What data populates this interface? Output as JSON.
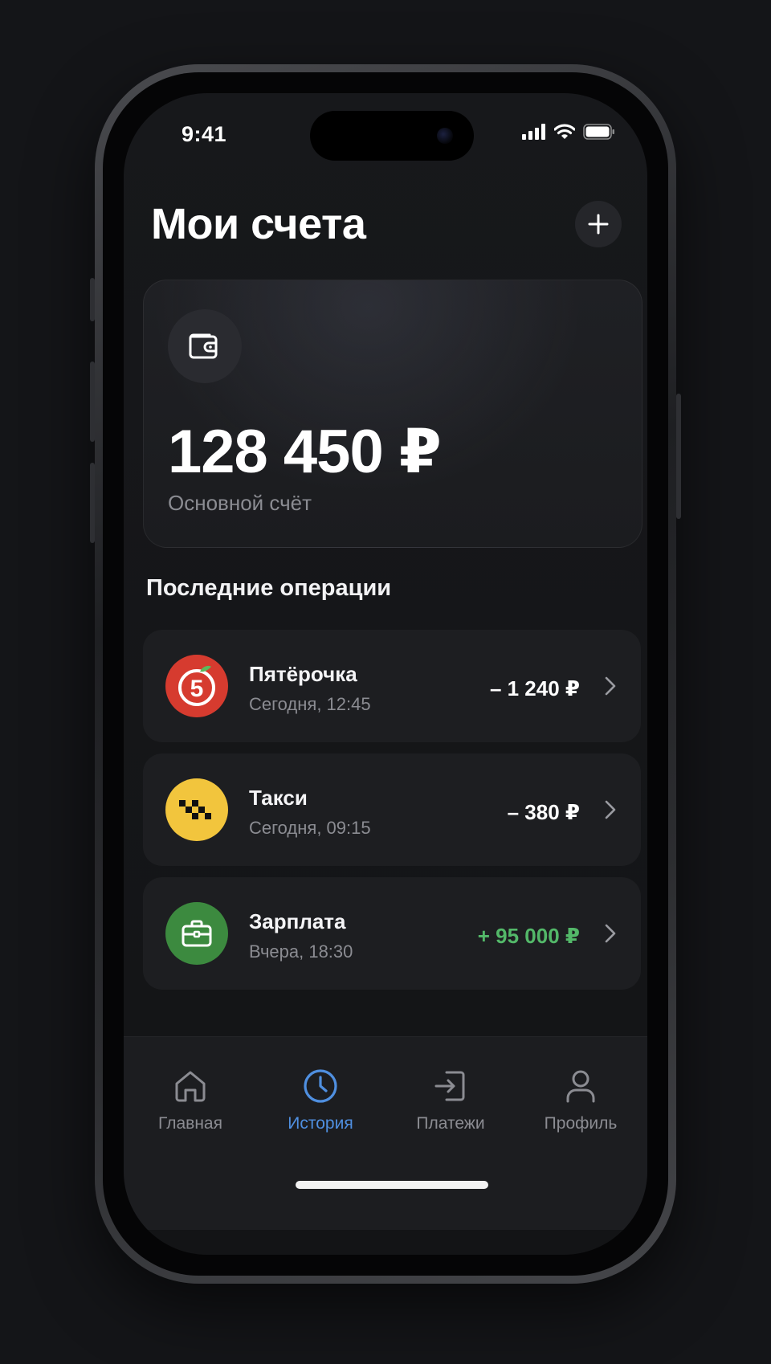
{
  "status_bar": {
    "time": "9:41"
  },
  "header": {
    "title": "Мои счета"
  },
  "account": {
    "balance": "128 450 ₽",
    "name": "Основной счёт"
  },
  "operations": {
    "title": "Последние операции",
    "items": [
      {
        "title": "Пятёрочка",
        "time": "Сегодня, 12:45",
        "amount": "– 1 240 ₽",
        "icon": "pyaterochka-logo-icon",
        "color": "#d63b2f"
      },
      {
        "title": "Такси",
        "time": "Сегодня, 09:15",
        "amount": "– 380 ₽",
        "icon": "taxi-icon",
        "color": "#f2c53d"
      },
      {
        "title": "Зарплата",
        "time": "Вчера, 18:30",
        "amount": "+ 95 000 ₽",
        "icon": "briefcase-icon",
        "color": "#3c8a3f"
      }
    ]
  },
  "tabbar": {
    "active": "История",
    "items": [
      {
        "label": "Главная",
        "icon": "home-icon"
      },
      {
        "label": "История",
        "icon": "clock-icon"
      },
      {
        "label": "Платежи",
        "icon": "payments-icon"
      },
      {
        "label": "Профиль",
        "icon": "user-icon"
      }
    ]
  },
  "colors": {
    "accent": "#4f8fe0",
    "positive": "#53b869"
  }
}
